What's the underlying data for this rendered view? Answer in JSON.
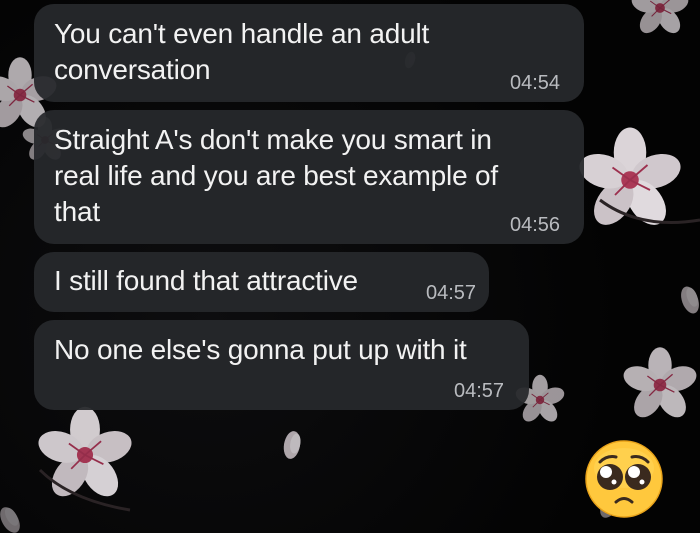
{
  "chat": {
    "messages": [
      {
        "lines": [
          "You can't even handle an adult",
          "conversation"
        ],
        "time": "04:54"
      },
      {
        "lines": [
          "Straight A's don't make you smart in",
          "real life and you are best example of",
          "that"
        ],
        "time": "04:56"
      },
      {
        "lines": [
          "I still found that attractive"
        ],
        "time": "04:57"
      },
      {
        "lines": [
          "No one else's gonna put up with it"
        ],
        "time": "04:57"
      }
    ],
    "reaction": {
      "icon": "pleading-face-emoji-icon",
      "colors": {
        "face": "#FFC83D",
        "outline": "#E8A21A",
        "eye": "#3A2A1E"
      }
    }
  },
  "wallpaper": {
    "theme": "cherry-blossom-dark",
    "colors": {
      "background": "#050505",
      "petal": "#E9E2E6",
      "petal_shadow": "#B9AEB5",
      "stamen": "#B43C5C"
    }
  },
  "bubble_color": "#26282C",
  "time_color": "#B9BBBF"
}
